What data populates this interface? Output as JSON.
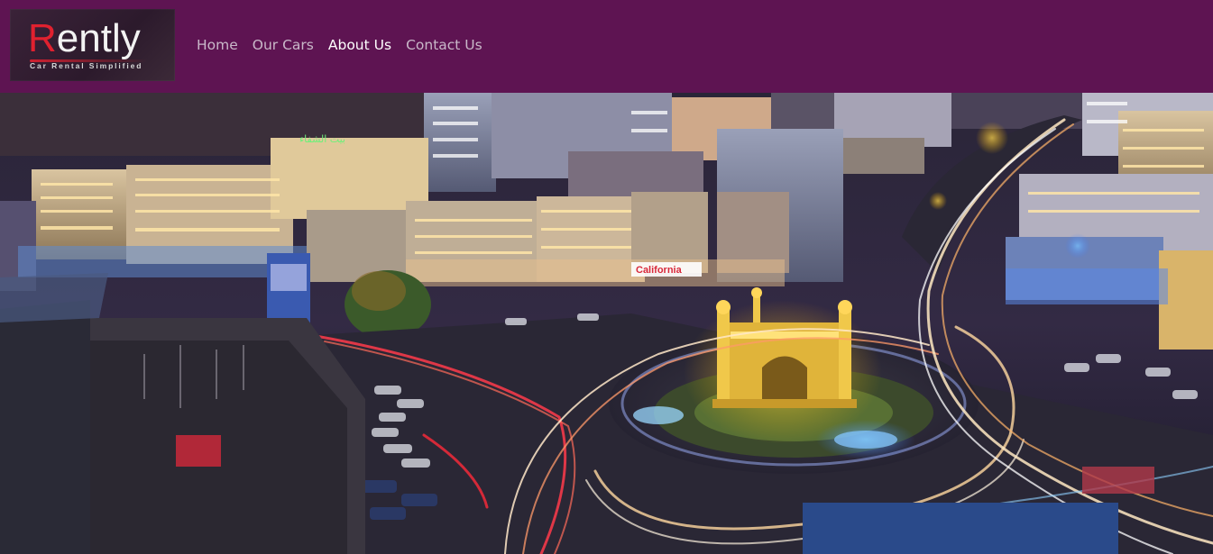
{
  "brand": {
    "name_initial": "R",
    "name_rest": "ently",
    "tagline": "Car Rental Simplified"
  },
  "nav": {
    "items": [
      {
        "label": "Home",
        "active": false
      },
      {
        "label": "Our Cars",
        "active": false
      },
      {
        "label": "About Us",
        "active": true
      },
      {
        "label": "Contact Us",
        "active": false
      }
    ]
  },
  "hero": {
    "image": "night-city-roundabout-photo",
    "signs": {
      "rooftop": "بيت الشفاء",
      "storefront": "California"
    }
  },
  "colors": {
    "navbar": "#5e1452",
    "nav_text": "#c9b8c9",
    "nav_active": "#ffffff",
    "logo_accent": "#e0212f"
  }
}
